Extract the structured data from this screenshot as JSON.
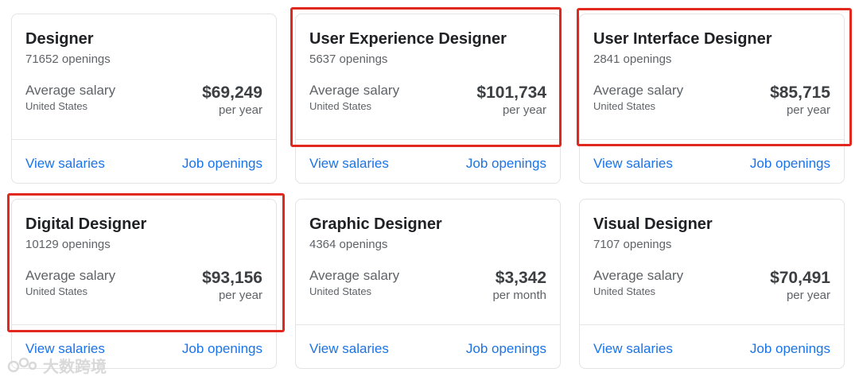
{
  "cards": [
    {
      "title": "Designer",
      "openings": "71652 openings",
      "avg_label": "Average salary",
      "country": "United States",
      "salary": "$69,249",
      "period": "per year",
      "view_salaries": "View salaries",
      "job_openings": "Job openings"
    },
    {
      "title": "User Experience Designer",
      "openings": "5637 openings",
      "avg_label": "Average salary",
      "country": "United States",
      "salary": "$101,734",
      "period": "per year",
      "view_salaries": "View salaries",
      "job_openings": "Job openings"
    },
    {
      "title": "User Interface Designer",
      "openings": "2841 openings",
      "avg_label": "Average salary",
      "country": "United States",
      "salary": "$85,715",
      "period": "per year",
      "view_salaries": "View salaries",
      "job_openings": "Job openings"
    },
    {
      "title": "Digital Designer",
      "openings": "10129 openings",
      "avg_label": "Average salary",
      "country": "United States",
      "salary": "$93,156",
      "period": "per year",
      "view_salaries": "View salaries",
      "job_openings": "Job openings"
    },
    {
      "title": "Graphic Designer",
      "openings": "4364 openings",
      "avg_label": "Average salary",
      "country": "United States",
      "salary": "$3,342",
      "period": "per month",
      "view_salaries": "View salaries",
      "job_openings": "Job openings"
    },
    {
      "title": "Visual Designer",
      "openings": "7107 openings",
      "avg_label": "Average salary",
      "country": "United States",
      "salary": "$70,491",
      "period": "per year",
      "view_salaries": "View salaries",
      "job_openings": "Job openings"
    }
  ],
  "watermark": {
    "text": "大数跨境"
  },
  "colors": {
    "link": "#1a73e8",
    "highlight": "#e0281f",
    "title": "#202124",
    "muted": "#5f6368"
  }
}
